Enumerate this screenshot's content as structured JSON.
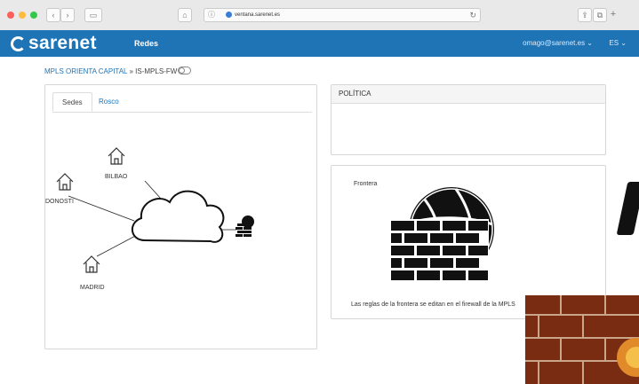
{
  "browser": {
    "url": "ventana.sarenet.es"
  },
  "header": {
    "logo_text": "sarenet",
    "section": "Redes",
    "user": "omago@sarenet.es ⌄",
    "lang": "ES ⌄"
  },
  "breadcrumb": {
    "parent": "MPLS ORIENTA CAPITAL",
    "separator": "»",
    "current": "IS-MPLS-FW"
  },
  "tabs": [
    {
      "label": "Sedes",
      "active": true
    },
    {
      "label": "Rosco",
      "active": false
    }
  ],
  "diagram": {
    "nodes": [
      {
        "label": "BILBAO"
      },
      {
        "label": "DONOSTI"
      },
      {
        "label": "MADRID"
      }
    ]
  },
  "politica": {
    "title": "POLÍTICA"
  },
  "frontera": {
    "title": "Frontera",
    "caption": "Las reglas de la frontera se editan en el firewall de la MPLS"
  },
  "colors": {
    "brand": "#1f74b6",
    "chrome": "#e9e9e9"
  }
}
